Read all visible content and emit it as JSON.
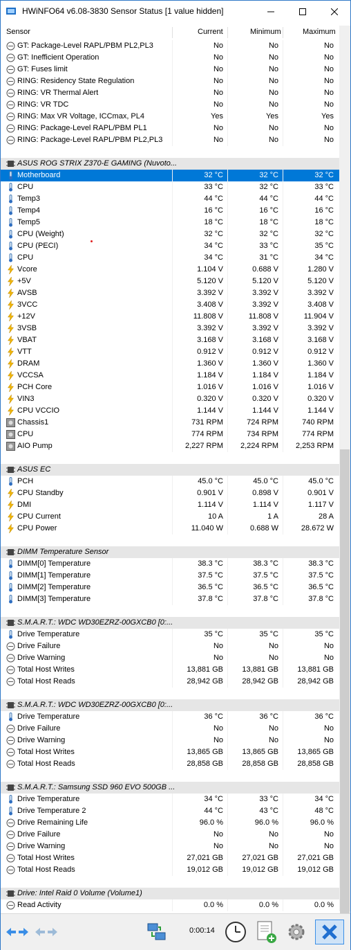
{
  "window": {
    "title": "HWiNFO64 v6.08-3830 Sensor Status [1 value hidden]"
  },
  "columns": {
    "sensor": "Sensor",
    "current": "Current",
    "minimum": "Minimum",
    "maximum": "Maximum"
  },
  "rows": [
    {
      "type": "row",
      "icon": "status",
      "name": "GT: Package-Level RAPL/PBM PL2,PL3",
      "cur": "No",
      "min": "No",
      "max": "No"
    },
    {
      "type": "row",
      "icon": "status",
      "name": "GT: Inefficient Operation",
      "cur": "No",
      "min": "No",
      "max": "No"
    },
    {
      "type": "row",
      "icon": "status",
      "name": "GT: Fuses limit",
      "cur": "No",
      "min": "No",
      "max": "No"
    },
    {
      "type": "row",
      "icon": "status",
      "name": "RING: Residency State Regulation",
      "cur": "No",
      "min": "No",
      "max": "No"
    },
    {
      "type": "row",
      "icon": "status",
      "name": "RING: VR Thermal Alert",
      "cur": "No",
      "min": "No",
      "max": "No"
    },
    {
      "type": "row",
      "icon": "status",
      "name": "RING: VR TDC",
      "cur": "No",
      "min": "No",
      "max": "No"
    },
    {
      "type": "row",
      "icon": "status",
      "name": "RING: Max VR Voltage, ICCmax, PL4",
      "cur": "Yes",
      "min": "Yes",
      "max": "Yes"
    },
    {
      "type": "row",
      "icon": "status",
      "name": "RING: Package-Level RAPL/PBM PL1",
      "cur": "No",
      "min": "No",
      "max": "No"
    },
    {
      "type": "row",
      "icon": "status",
      "name": "RING: Package-Level RAPL/PBM PL2,PL3",
      "cur": "No",
      "min": "No",
      "max": "No"
    },
    {
      "type": "blank"
    },
    {
      "type": "group",
      "name": "ASUS ROG STRIX Z370-E GAMING (Nuvoto..."
    },
    {
      "type": "row",
      "icon": "temp",
      "name": "Motherboard",
      "cur": "32 °C",
      "min": "32 °C",
      "max": "32 °C",
      "selected": true
    },
    {
      "type": "row",
      "icon": "temp",
      "name": "CPU",
      "cur": "33 °C",
      "min": "32 °C",
      "max": "33 °C"
    },
    {
      "type": "row",
      "icon": "temp",
      "name": "Temp3",
      "cur": "44 °C",
      "min": "44 °C",
      "max": "44 °C"
    },
    {
      "type": "row",
      "icon": "temp",
      "name": "Temp4",
      "cur": "16 °C",
      "min": "16 °C",
      "max": "16 °C"
    },
    {
      "type": "row",
      "icon": "temp",
      "name": "Temp5",
      "cur": "18 °C",
      "min": "18 °C",
      "max": "18 °C"
    },
    {
      "type": "row",
      "icon": "temp",
      "name": "CPU (Weight)",
      "cur": "32 °C",
      "min": "32 °C",
      "max": "32 °C"
    },
    {
      "type": "row",
      "icon": "temp",
      "name": "CPU (PECI)",
      "cur": "34 °C",
      "min": "33 °C",
      "max": "35 °C"
    },
    {
      "type": "row",
      "icon": "temp",
      "name": "CPU",
      "cur": "34 °C",
      "min": "31 °C",
      "max": "34 °C"
    },
    {
      "type": "row",
      "icon": "volt",
      "name": "Vcore",
      "cur": "1.104 V",
      "min": "0.688 V",
      "max": "1.280 V"
    },
    {
      "type": "row",
      "icon": "volt",
      "name": "+5V",
      "cur": "5.120 V",
      "min": "5.120 V",
      "max": "5.120 V"
    },
    {
      "type": "row",
      "icon": "volt",
      "name": "AVSB",
      "cur": "3.392 V",
      "min": "3.392 V",
      "max": "3.392 V"
    },
    {
      "type": "row",
      "icon": "volt",
      "name": "3VCC",
      "cur": "3.408 V",
      "min": "3.392 V",
      "max": "3.408 V"
    },
    {
      "type": "row",
      "icon": "volt",
      "name": "+12V",
      "cur": "11.808 V",
      "min": "11.808 V",
      "max": "11.904 V"
    },
    {
      "type": "row",
      "icon": "volt",
      "name": "3VSB",
      "cur": "3.392 V",
      "min": "3.392 V",
      "max": "3.392 V"
    },
    {
      "type": "row",
      "icon": "volt",
      "name": "VBAT",
      "cur": "3.168 V",
      "min": "3.168 V",
      "max": "3.168 V"
    },
    {
      "type": "row",
      "icon": "volt",
      "name": "VTT",
      "cur": "0.912 V",
      "min": "0.912 V",
      "max": "0.912 V"
    },
    {
      "type": "row",
      "icon": "volt",
      "name": "DRAM",
      "cur": "1.360 V",
      "min": "1.360 V",
      "max": "1.360 V"
    },
    {
      "type": "row",
      "icon": "volt",
      "name": "VCCSA",
      "cur": "1.184 V",
      "min": "1.184 V",
      "max": "1.184 V"
    },
    {
      "type": "row",
      "icon": "volt",
      "name": "PCH Core",
      "cur": "1.016 V",
      "min": "1.016 V",
      "max": "1.016 V"
    },
    {
      "type": "row",
      "icon": "volt",
      "name": "VIN3",
      "cur": "0.320 V",
      "min": "0.320 V",
      "max": "0.320 V"
    },
    {
      "type": "row",
      "icon": "volt",
      "name": "CPU VCCIO",
      "cur": "1.144 V",
      "min": "1.144 V",
      "max": "1.144 V"
    },
    {
      "type": "row",
      "icon": "fan",
      "name": "Chassis1",
      "cur": "731 RPM",
      "min": "724 RPM",
      "max": "740 RPM"
    },
    {
      "type": "row",
      "icon": "fan",
      "name": "CPU",
      "cur": "774 RPM",
      "min": "734 RPM",
      "max": "774 RPM"
    },
    {
      "type": "row",
      "icon": "fan",
      "name": "AIO Pump",
      "cur": "2,227 RPM",
      "min": "2,224 RPM",
      "max": "2,253 RPM"
    },
    {
      "type": "blank"
    },
    {
      "type": "group",
      "name": "ASUS EC"
    },
    {
      "type": "row",
      "icon": "temp",
      "name": "PCH",
      "cur": "45.0 °C",
      "min": "45.0 °C",
      "max": "45.0 °C"
    },
    {
      "type": "row",
      "icon": "volt",
      "name": "CPU Standby",
      "cur": "0.901 V",
      "min": "0.898 V",
      "max": "0.901 V"
    },
    {
      "type": "row",
      "icon": "volt",
      "name": "DMI",
      "cur": "1.114 V",
      "min": "1.114 V",
      "max": "1.117 V"
    },
    {
      "type": "row",
      "icon": "volt",
      "name": "CPU Current",
      "cur": "10 A",
      "min": "1 A",
      "max": "28 A"
    },
    {
      "type": "row",
      "icon": "volt",
      "name": "CPU Power",
      "cur": "11.040 W",
      "min": "0.688 W",
      "max": "28.672 W"
    },
    {
      "type": "blank"
    },
    {
      "type": "group",
      "name": "DIMM Temperature Sensor"
    },
    {
      "type": "row",
      "icon": "temp",
      "name": "DIMM[0] Temperature",
      "cur": "38.3 °C",
      "min": "38.3 °C",
      "max": "38.3 °C"
    },
    {
      "type": "row",
      "icon": "temp",
      "name": "DIMM[1] Temperature",
      "cur": "37.5 °C",
      "min": "37.5 °C",
      "max": "37.5 °C"
    },
    {
      "type": "row",
      "icon": "temp",
      "name": "DIMM[2] Temperature",
      "cur": "36.5 °C",
      "min": "36.5 °C",
      "max": "36.5 °C"
    },
    {
      "type": "row",
      "icon": "temp",
      "name": "DIMM[3] Temperature",
      "cur": "37.8 °C",
      "min": "37.8 °C",
      "max": "37.8 °C"
    },
    {
      "type": "blank"
    },
    {
      "type": "group",
      "name": "S.M.A.R.T.: WDC WD30EZRZ-00GXCB0 [0:..."
    },
    {
      "type": "row",
      "icon": "temp",
      "name": "Drive Temperature",
      "cur": "35 °C",
      "min": "35 °C",
      "max": "35 °C"
    },
    {
      "type": "row",
      "icon": "status",
      "name": "Drive Failure",
      "cur": "No",
      "min": "No",
      "max": "No"
    },
    {
      "type": "row",
      "icon": "status",
      "name": "Drive Warning",
      "cur": "No",
      "min": "No",
      "max": "No"
    },
    {
      "type": "row",
      "icon": "status",
      "name": "Total Host Writes",
      "cur": "13,881 GB",
      "min": "13,881 GB",
      "max": "13,881 GB"
    },
    {
      "type": "row",
      "icon": "status",
      "name": "Total Host Reads",
      "cur": "28,942 GB",
      "min": "28,942 GB",
      "max": "28,942 GB"
    },
    {
      "type": "blank"
    },
    {
      "type": "group",
      "name": "S.M.A.R.T.: WDC WD30EZRZ-00GXCB0 [0:..."
    },
    {
      "type": "row",
      "icon": "temp",
      "name": "Drive Temperature",
      "cur": "36 °C",
      "min": "36 °C",
      "max": "36 °C"
    },
    {
      "type": "row",
      "icon": "status",
      "name": "Drive Failure",
      "cur": "No",
      "min": "No",
      "max": "No"
    },
    {
      "type": "row",
      "icon": "status",
      "name": "Drive Warning",
      "cur": "No",
      "min": "No",
      "max": "No"
    },
    {
      "type": "row",
      "icon": "status",
      "name": "Total Host Writes",
      "cur": "13,865 GB",
      "min": "13,865 GB",
      "max": "13,865 GB"
    },
    {
      "type": "row",
      "icon": "status",
      "name": "Total Host Reads",
      "cur": "28,858 GB",
      "min": "28,858 GB",
      "max": "28,858 GB"
    },
    {
      "type": "blank"
    },
    {
      "type": "group",
      "name": "S.M.A.R.T.: Samsung SSD 960 EVO 500GB ..."
    },
    {
      "type": "row",
      "icon": "temp",
      "name": "Drive Temperature",
      "cur": "34 °C",
      "min": "33 °C",
      "max": "34 °C"
    },
    {
      "type": "row",
      "icon": "temp",
      "name": "Drive Temperature 2",
      "cur": "44 °C",
      "min": "43 °C",
      "max": "48 °C"
    },
    {
      "type": "row",
      "icon": "status",
      "name": "Drive Remaining Life",
      "cur": "96.0 %",
      "min": "96.0 %",
      "max": "96.0 %"
    },
    {
      "type": "row",
      "icon": "status",
      "name": "Drive Failure",
      "cur": "No",
      "min": "No",
      "max": "No"
    },
    {
      "type": "row",
      "icon": "status",
      "name": "Drive Warning",
      "cur": "No",
      "min": "No",
      "max": "No"
    },
    {
      "type": "row",
      "icon": "status",
      "name": "Total Host Writes",
      "cur": "27,021 GB",
      "min": "27,021 GB",
      "max": "27,021 GB"
    },
    {
      "type": "row",
      "icon": "status",
      "name": "Total Host Reads",
      "cur": "19,012 GB",
      "min": "19,012 GB",
      "max": "19,012 GB"
    },
    {
      "type": "blank"
    },
    {
      "type": "group",
      "name": "Drive: Intel Raid 0 Volume (Volume1)"
    },
    {
      "type": "row",
      "icon": "status",
      "name": "Read Activity",
      "cur": "0.0 %",
      "min": "0.0 %",
      "max": "0.0 %"
    }
  ],
  "statusbar": {
    "timer": "0:00:14"
  },
  "colors": {
    "selection": "#0078d7",
    "group_bg": "#e6e6e6",
    "accent": "#2f78c8"
  }
}
